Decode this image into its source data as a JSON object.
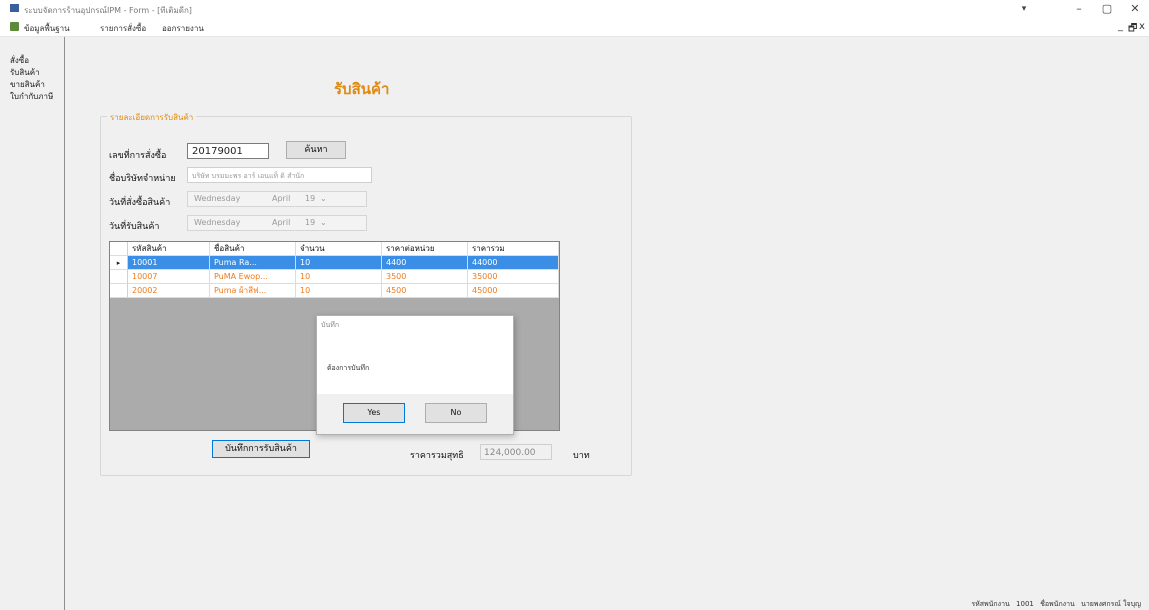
{
  "window": {
    "title": "ระบบจัดการร้านอุปกรณ์IPM - Form - [ทีเติมดีก]"
  },
  "menu": {
    "items": [
      "ข้อมูลพื้นฐาน",
      "รายการสั่งซื้อ",
      "ออกรายงาน"
    ],
    "mdi_controls": [
      "_",
      "🗗",
      "x"
    ]
  },
  "sidebar": {
    "items": [
      "สั่งซื้อ",
      "รับสินค้า",
      "ขายสินค้า",
      "ใบกำกับภาษี"
    ]
  },
  "form": {
    "title": "รับสินค้า",
    "group_title": "รายละเอียดการรับสินค้า",
    "order_no_label": "เลขที่การสั่งซื้อ",
    "order_no_value": "20179001",
    "search_button": "ค้นหา",
    "supplier_label": "ชื่อบริษัทจำหน่าย",
    "supplier_value": "บริษัท บรมมะพร อาร์ เอนแท็ ดิ สำนัก",
    "order_date_label": "วันที่สั่งซื้อสินค้า",
    "order_date": {
      "weekday": "Wednesday",
      "month": "April",
      "day": "19"
    },
    "receive_date_label": "วันที่รับสินค้า",
    "receive_date": {
      "weekday": "Wednesday",
      "month": "April",
      "day": "19"
    },
    "save_button": "บันทึกการรับสินค้า",
    "total_label": "ราคารวมสุทธิ",
    "total_value": "124,000.00",
    "currency": "บาท"
  },
  "grid": {
    "columns": [
      "รหัสสินค้า",
      "ชื่อสินค้า",
      "จำนวน",
      "ราคาต่อหน่วย",
      "ราคารวม"
    ],
    "rows": [
      [
        "10001",
        "Puma Ra...",
        "10",
        "4400",
        "44000"
      ],
      [
        "10007",
        "PuMA Ewop...",
        "10",
        "3500",
        "35000"
      ],
      [
        "20002",
        "Puma ผ้าสีฟ...",
        "10",
        "4500",
        "45000"
      ]
    ],
    "selected_row": 0,
    "row_marker": "▸"
  },
  "dialog": {
    "title": "บันทึก",
    "message": "ต้องการบันทึก",
    "yes_label": "Yes",
    "no_label": "No"
  },
  "statusbar": {
    "items": [
      "รหัสพนักงาน",
      "1001",
      "ชื่อพนักงาน",
      "นายพงศกรณ์ ใจบุญ"
    ]
  },
  "colors": {
    "accent": "#e08a10",
    "selection": "#3b8ee6",
    "row_text": "#f07a1a"
  }
}
